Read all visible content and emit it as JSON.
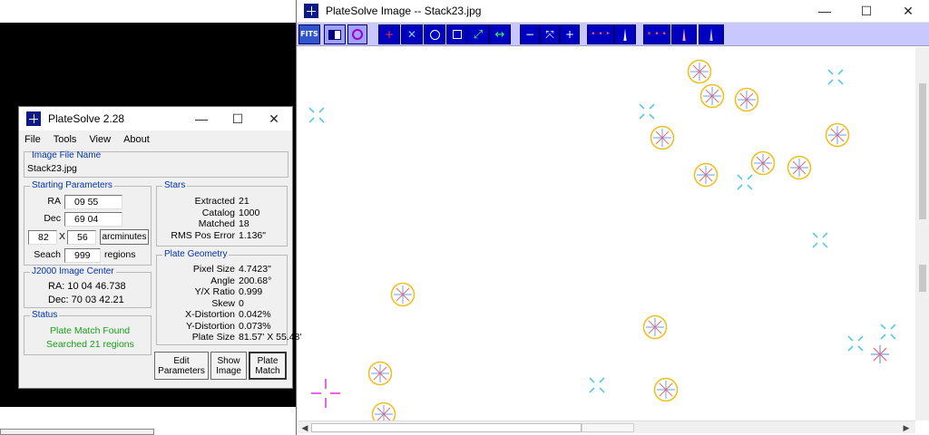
{
  "image_window": {
    "title": "PlateSolve Image -- Stack23.jpg",
    "controls": {
      "minimize": "—",
      "maximize": "☐",
      "close": "✕"
    },
    "toolbar": {
      "fits_label": "FITS",
      "buttons": [
        "invert",
        "circle-target",
        "cross-red",
        "cross-blue",
        "circle-outline",
        "flip-green",
        "expand-horizontal",
        "−",
        "fit",
        "+",
        "stars-left",
        "histogram",
        "stars-right",
        "histogram-red",
        "histogram-blue"
      ]
    }
  },
  "platesolve_window": {
    "title": "PlateSolve 2.28",
    "menu": [
      "File",
      "Tools",
      "View",
      "About"
    ],
    "image_file": {
      "group_title": "Image File Name",
      "value": "Stack23.jpg"
    },
    "starting_parameters": {
      "group_title": "Starting Parameters",
      "ra_label": "RA",
      "ra_value": "09 55",
      "dec_label": "Dec",
      "dec_value": "69 04",
      "width_value": "82",
      "times": "X",
      "height_value": "56",
      "units_button": "arcminutes",
      "search_label": "Seach",
      "search_value": "999",
      "search_units": "regions"
    },
    "center": {
      "group_title": "J2000 Image Center",
      "ra": "RA: 10 04 46.738",
      "dec": "Dec: 70 03 42.21"
    },
    "status": {
      "group_title": "Status",
      "line1": "Plate Match Found",
      "line2": "Searched 21 regions",
      "color": "#18a018"
    },
    "stars": {
      "group_title": "Stars",
      "rows": [
        {
          "label": "Extracted",
          "value": "21"
        },
        {
          "label": "Catalog",
          "value": "1000"
        },
        {
          "label": "Matched",
          "value": "18"
        },
        {
          "label": "RMS Pos Error",
          "value": "1.136\""
        }
      ]
    },
    "plate_geometry": {
      "group_title": "Plate Geometry",
      "rows": [
        {
          "label": "Pixel Size",
          "value": "4.7423\""
        },
        {
          "label": "Angle",
          "value": "200.68°"
        },
        {
          "label": "Y/X Ratio",
          "value": "0.999"
        },
        {
          "label": "Skew",
          "value": "0"
        },
        {
          "label": "X-Distortion",
          "value": "0.042%"
        },
        {
          "label": "Y-Distortion",
          "value": "0.073%"
        },
        {
          "label": "Plate Size",
          "value": "81.57' X 55.48'"
        }
      ]
    },
    "buttons": {
      "edit_1": "Edit",
      "edit_2": "Parameters",
      "show_1": "Show",
      "show_2": "Image",
      "plate_1": "Plate",
      "plate_2": "Match"
    }
  },
  "colors": {
    "toolbar_bg": "#c8c8ff",
    "matched_ring": "#f0c020",
    "unmatched_cross": "#40c8e8",
    "center_marker": "#e040e0"
  }
}
